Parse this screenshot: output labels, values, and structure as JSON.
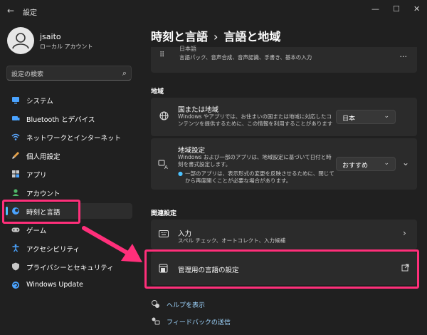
{
  "window": {
    "back_icon": "back-arrow-icon",
    "title": "設定",
    "controls": [
      "—",
      "☐",
      "✕"
    ]
  },
  "user": {
    "name": "jsaito",
    "type": "ローカル アカウント"
  },
  "search": {
    "placeholder": "設定の検索"
  },
  "sidebar": {
    "items": [
      {
        "label": "システム",
        "icon": "monitor-icon",
        "color": "#4aa3ff"
      },
      {
        "label": "Bluetooth とデバイス",
        "icon": "bluetooth-icon",
        "color": "#4aa3ff"
      },
      {
        "label": "ネットワークとインターネット",
        "icon": "wifi-icon",
        "color": "#5aa7ff"
      },
      {
        "label": "個人用設定",
        "icon": "brush-icon",
        "color": "#e6a24a"
      },
      {
        "label": "アプリ",
        "icon": "apps-icon",
        "color": "#c8c8c8"
      },
      {
        "label": "アカウント",
        "icon": "account-icon",
        "color": "#4fb868"
      },
      {
        "label": "時刻と言語",
        "icon": "clock-globe-icon",
        "color": "#4aa3ff",
        "selected": true
      },
      {
        "label": "ゲーム",
        "icon": "gamepad-icon",
        "color": "#c8c8c8"
      },
      {
        "label": "アクセシビリティ",
        "icon": "accessibility-icon",
        "color": "#4aa3ff"
      },
      {
        "label": "プライバシーとセキュリティ",
        "icon": "shield-icon",
        "color": "#c8c8c8"
      },
      {
        "label": "Windows Update",
        "icon": "update-icon",
        "color": "#4aa3ff"
      }
    ]
  },
  "breadcrumb": {
    "parent": "時刻と言語",
    "separator": "›",
    "current": "言語と地域"
  },
  "top_card": {
    "title": "日本語",
    "desc": "言語パック、音声合成、音声認識、手書き、基本の入力",
    "more": "..."
  },
  "region_section": {
    "label": "地域",
    "country": {
      "title": "国または地域",
      "desc": "Windows やアプリでは、お住まいの国または地域に対応したコンテンツを提供するために、この情報を利用することがあります",
      "value": "日本"
    },
    "format": {
      "title": "地域設定",
      "desc": "Windows および一部のアプリは、地域設定に基づいて日付と時刻を書式設定します。",
      "info": "一部のアプリは、表示形式の変更を反映させるために、閉じてから再度開くことが必要な場合があります。",
      "value": "おすすめ"
    }
  },
  "related_section": {
    "label": "関連設定",
    "typing": {
      "title": "入力",
      "desc": "スペル チェック、オートコレクト、入力候補"
    },
    "admin": {
      "title": "管理用の言語の設定"
    }
  },
  "footer_links": {
    "help": "ヘルプを表示",
    "feedback": "フィードバックの送信"
  },
  "annotation_color": "#ff2f7a"
}
